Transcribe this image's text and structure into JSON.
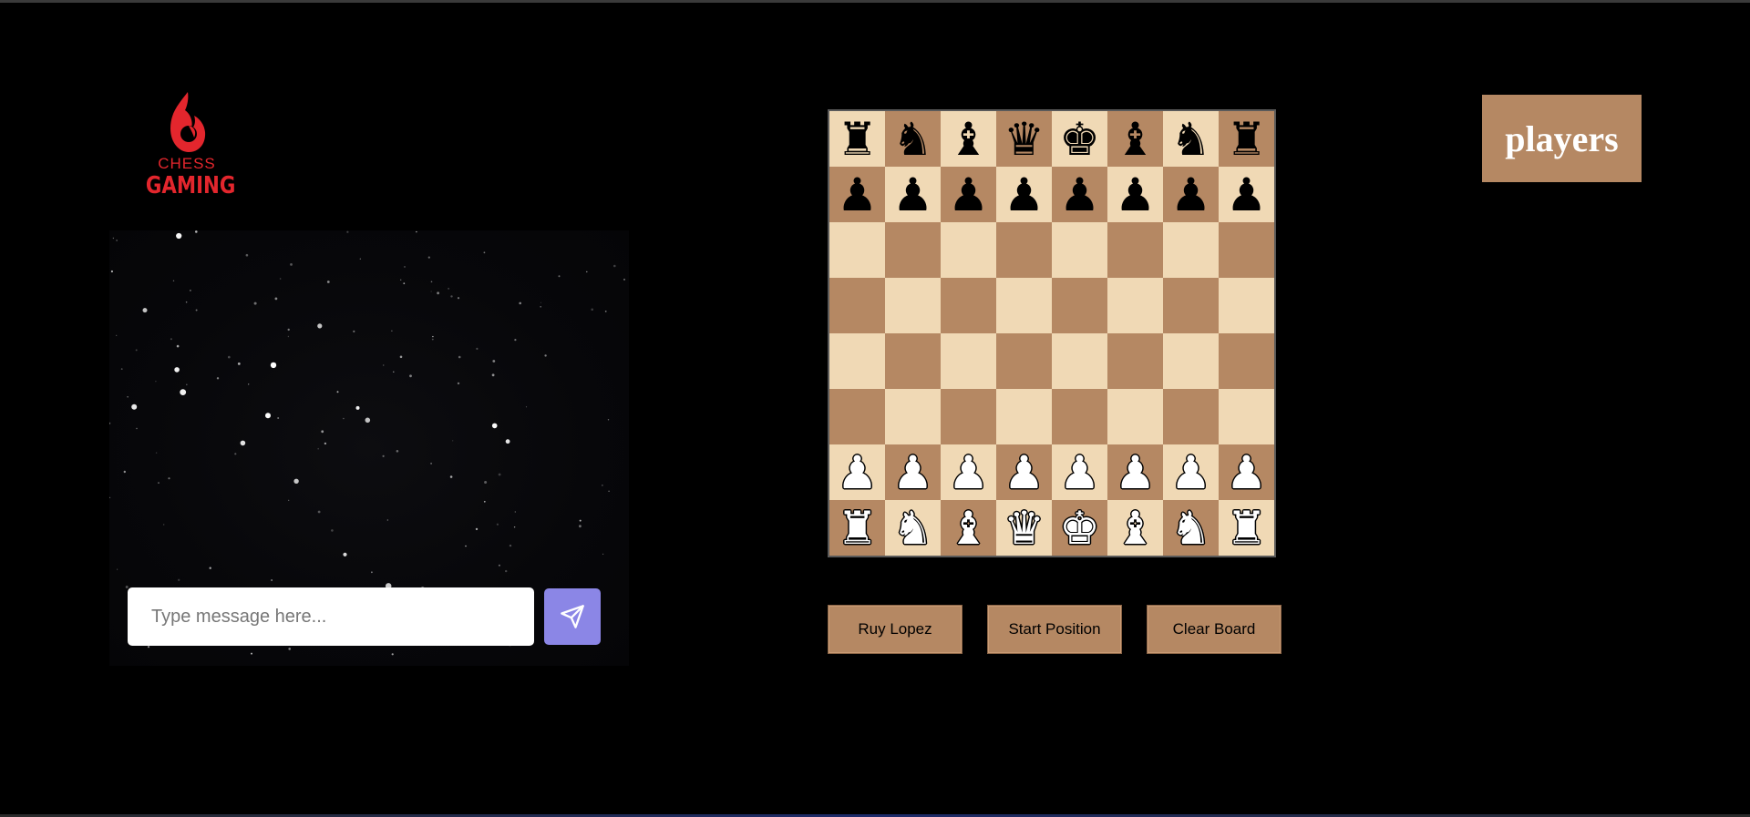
{
  "logo": {
    "line1": "CHESS",
    "line2": "GAMING",
    "color": "#e3262d"
  },
  "chat": {
    "placeholder": "Type message here...",
    "value": "",
    "send_icon": "paper-plane-icon",
    "send_color": "#8b86e6"
  },
  "board": {
    "light_color": "#f0d9b5",
    "dark_color": "#b58863",
    "ranks": [
      [
        "br",
        "bn",
        "bb",
        "bq",
        "bk",
        "bb",
        "bn",
        "br"
      ],
      [
        "bp",
        "bp",
        "bp",
        "bp",
        "bp",
        "bp",
        "bp",
        "bp"
      ],
      [
        "",
        "",
        "",
        "",
        "",
        "",
        "",
        ""
      ],
      [
        "",
        "",
        "",
        "",
        "",
        "",
        "",
        ""
      ],
      [
        "",
        "",
        "",
        "",
        "",
        "",
        "",
        ""
      ],
      [
        "",
        "",
        "",
        "",
        "",
        "",
        "",
        ""
      ],
      [
        "wp",
        "wp",
        "wp",
        "wp",
        "wp",
        "wp",
        "wp",
        "wp"
      ],
      [
        "wr",
        "wn",
        "wb",
        "wq",
        "wk",
        "wb",
        "wn",
        "wr"
      ]
    ]
  },
  "controls": {
    "ruy_lopez": "Ruy Lopez",
    "start_position": "Start Position",
    "clear_board": "Clear Board"
  },
  "players": {
    "label": "players"
  }
}
